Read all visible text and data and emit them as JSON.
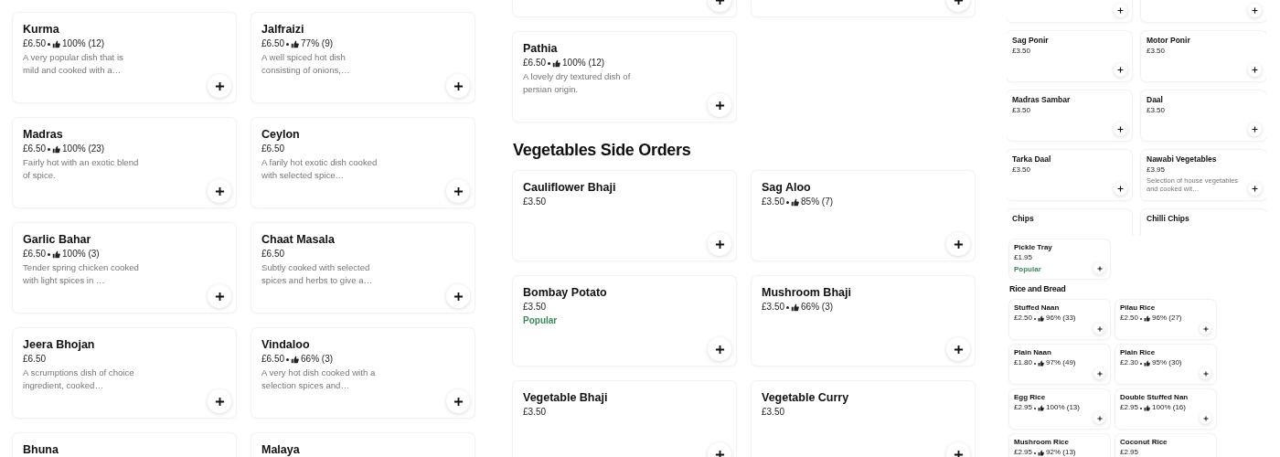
{
  "panels": [
    {
      "sections": [
        {
          "items": [
            {
              "name": "Kurma",
              "price": "£6.50",
              "rating": "100% (12)",
              "description": "A very popular dish that is mild and cooked with a…"
            },
            {
              "name": "Jalfraizi",
              "price": "£6.50",
              "rating": "77% (9)",
              "description": "A well spiced hot dish consisting of onions,…"
            },
            {
              "name": "Madras",
              "price": "£6.50",
              "rating": "100% (23)",
              "description": "Fairly hot with an exotic blend of spice."
            },
            {
              "name": "Ceylon",
              "price": "£6.50",
              "description": "A farily hot exotic dish cooked with selected spice…"
            },
            {
              "name": "Garlic Bahar",
              "price": "£6.50",
              "rating": "100% (3)",
              "description": "Tender spring chicken cooked with light spices in …"
            },
            {
              "name": "Chaat Masala",
              "price": "£6.50",
              "description": "Subtly cooked with selected spices and herbs to give a…"
            },
            {
              "name": "Jeera Bhojan",
              "price": "£6.50",
              "description": "A scrumptions dish of choice ingredient, cooked…"
            },
            {
              "name": "Vindaloo",
              "price": "£6.50",
              "rating": "66% (3)",
              "description": "A very hot dish cooked with a selection spices and…"
            },
            {
              "name": "Bhuna"
            },
            {
              "name": "Malaya"
            }
          ]
        }
      ]
    },
    {
      "cut_cards": [
        {
          "kind": "card"
        },
        {
          "kind": "card"
        }
      ],
      "sections": [
        {
          "items": [
            {
              "name": "Pathia",
              "price": "£6.50",
              "rating": "100% (12)",
              "description": "A lovely dry textured dish of persian origin."
            }
          ]
        },
        {
          "heading": "Vegetables Side Orders",
          "items": [
            {
              "name": "Cauliflower Bhaji",
              "price": "£3.50"
            },
            {
              "name": "Sag Aloo",
              "price": "£3.50",
              "rating": "85% (7)"
            },
            {
              "name": "Bombay Potato",
              "price": "£3.50",
              "badge": "Popular"
            },
            {
              "name": "Mushroom Bhaji",
              "price": "£3.50",
              "rating": "66% (3)"
            },
            {
              "name": "Vegetable Bhaji",
              "price": "£3.50"
            },
            {
              "name": "Vegetable Curry",
              "price": "£3.50"
            }
          ]
        }
      ]
    },
    {
      "cut_cards": [
        {
          "kind": "card"
        },
        {
          "kind": "card"
        }
      ],
      "sections": [
        {
          "items": [
            {
              "name": "Sag Ponir",
              "price": "£3.50"
            },
            {
              "name": "Motor Ponir",
              "price": "£3.50"
            },
            {
              "name": "Madras Sambar",
              "price": "£3.50"
            },
            {
              "name": "Daal",
              "price": "£3.50"
            },
            {
              "name": "Tarka Daal",
              "price": "£3.50"
            },
            {
              "name": "Nawabi Vegetables",
              "price": "£3.95",
              "description": "Selection of house vegetables and cooked wit…"
            },
            {
              "name": "Chips"
            },
            {
              "name": "Chilli Chips"
            }
          ]
        }
      ]
    },
    {
      "sections": [
        {
          "items": [
            {
              "name": "Pickle Tray",
              "price": "£1.95",
              "badge": "Popular"
            }
          ]
        },
        {
          "heading": "Rice and Bread",
          "items": [
            {
              "name": "Stuffed Naan",
              "price": "£2.50",
              "rating": "96% (33)"
            },
            {
              "name": "Pilau Rice",
              "price": "£2.50",
              "rating": "96% (27)"
            },
            {
              "name": "Plain Naan",
              "price": "£1.80",
              "rating": "97% (49)"
            },
            {
              "name": "Plain Rice",
              "price": "£2.30",
              "rating": "95% (30)"
            },
            {
              "name": "Egg Rice",
              "price": "£2.95",
              "rating": "100% (13)"
            },
            {
              "name": "Double Stuffed Nan",
              "price": "£2.95",
              "rating": "100% (16)"
            },
            {
              "name": "Mushroom Rice",
              "price": "£2.95",
              "rating": "92% (13)",
              "add_button": false
            },
            {
              "name": "Coconut Rice",
              "price": "£2.95",
              "add_button": false
            }
          ]
        }
      ]
    }
  ]
}
